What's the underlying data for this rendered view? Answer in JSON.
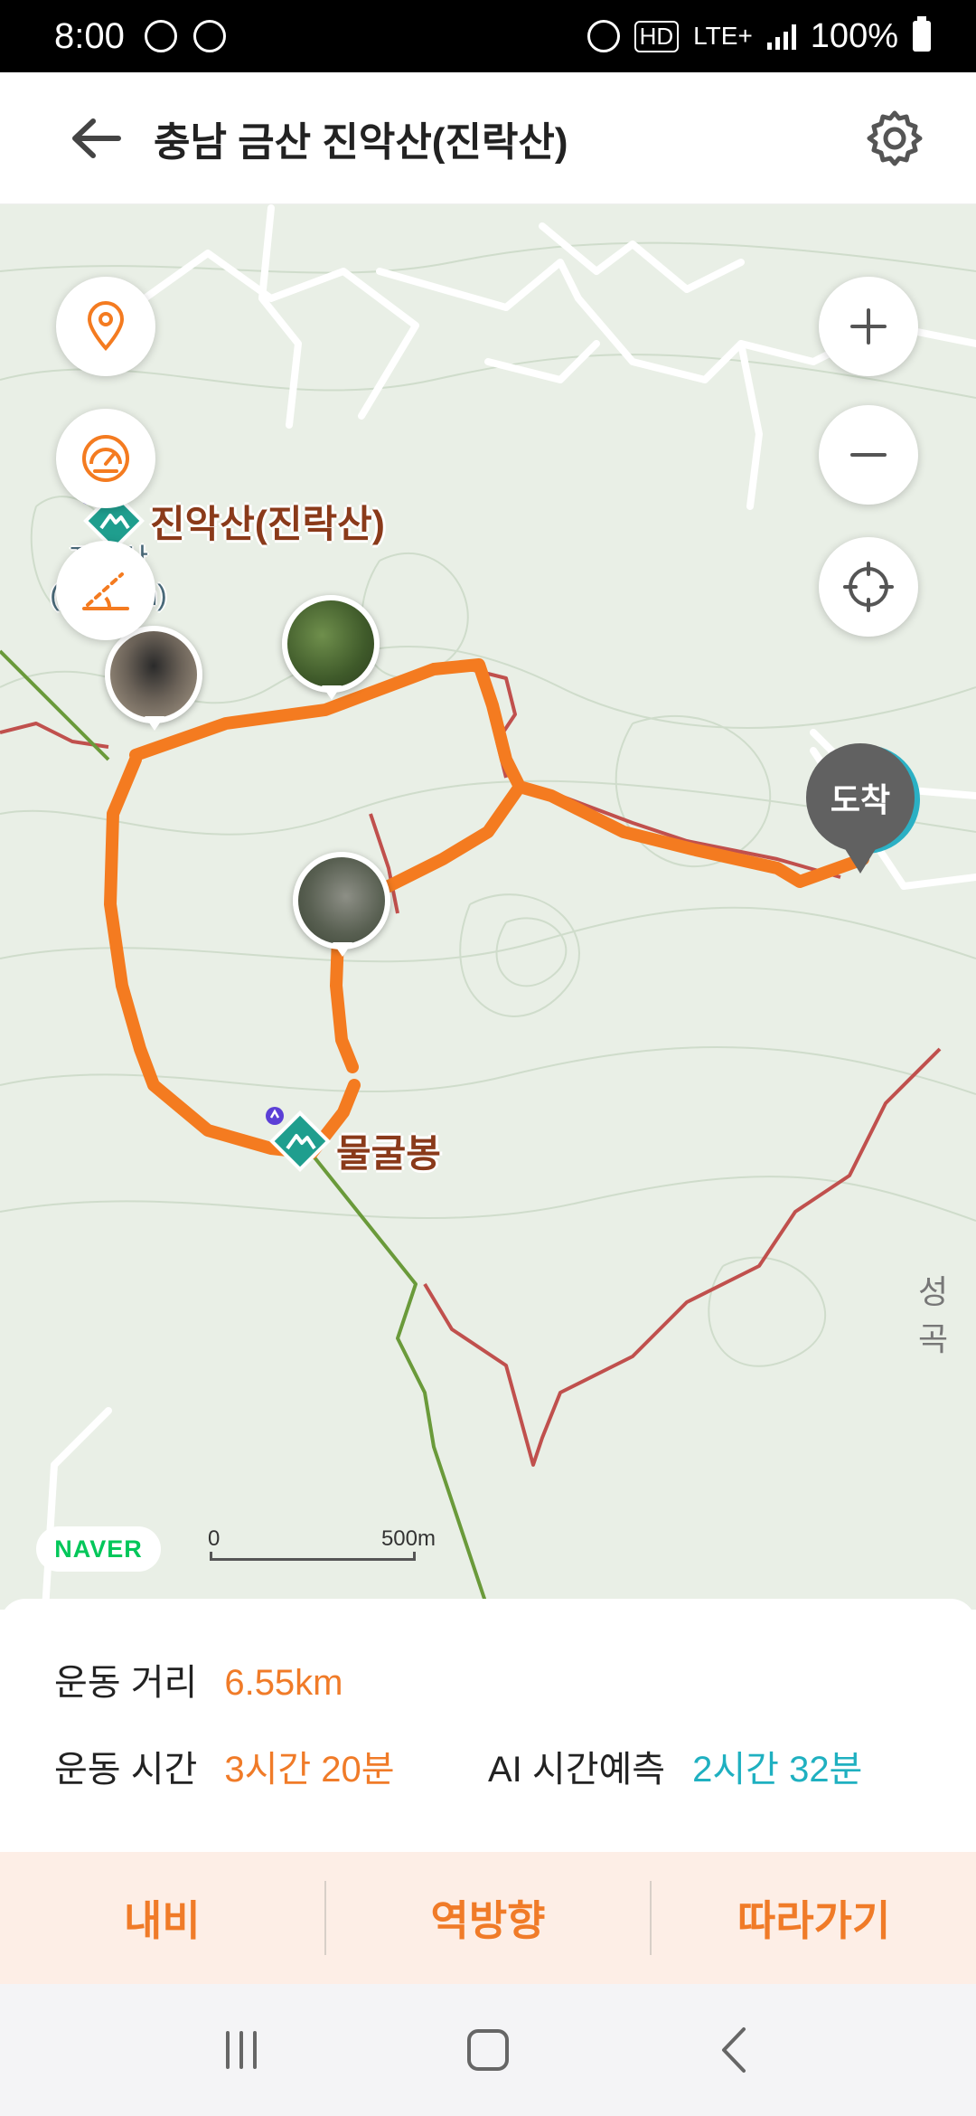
{
  "status_bar": {
    "time": "8:00",
    "network": "LTE+",
    "hd": "HD",
    "battery": "100%"
  },
  "header": {
    "title": "충남 금산 진악산(진락산)"
  },
  "map": {
    "peaks": [
      {
        "name": "진악산(진락산)",
        "sub_name": "진악산",
        "sub_elev": "(732.■m)"
      },
      {
        "name": "물굴봉"
      }
    ],
    "arrival_label": "도착",
    "side_label": "성곡",
    "naver_logo": "NAVER",
    "scale": {
      "zero": "0",
      "distance": "500m"
    },
    "colors": {
      "route": "#f47b20",
      "trail_red": "#c0504d",
      "trail_green": "#6a9a3a",
      "map_bg": "#e9efe6"
    }
  },
  "stats": {
    "distance_label": "운동 거리",
    "distance_value": "6.55km",
    "time_label": "운동 시간",
    "time_value": "3시간 20분",
    "ai_label": "AI 시간예측",
    "ai_value": "2시간 32분"
  },
  "actions": {
    "navi": "내비",
    "reverse": "역방향",
    "follow": "따라가기"
  }
}
